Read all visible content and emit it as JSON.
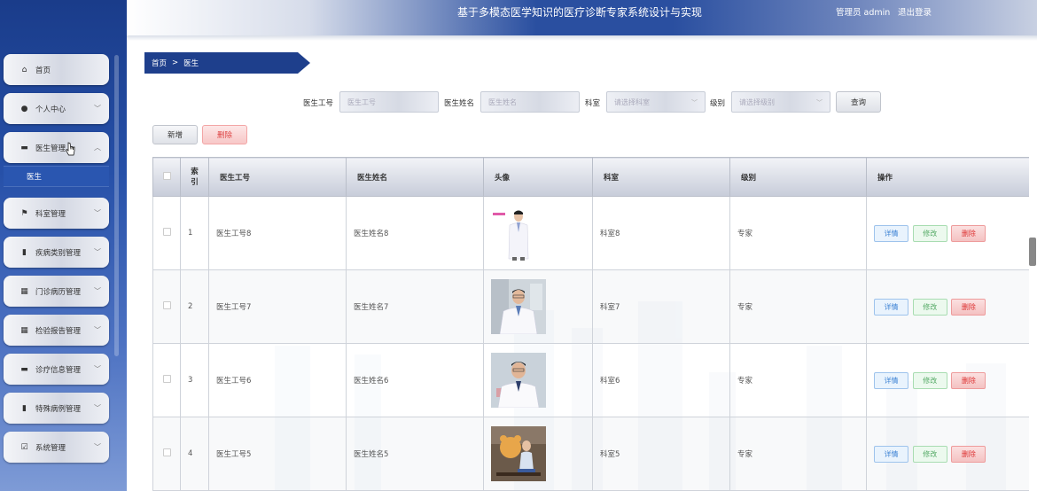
{
  "header": {
    "title": "基于多模态医学知识的医疗诊断专家系统设计与实现",
    "user": "管理员 admin",
    "logout": "退出登录"
  },
  "sidebar": {
    "items": [
      {
        "label": "首页",
        "icon": "home-icon",
        "glyph": "⌂"
      },
      {
        "label": "个人中心",
        "icon": "person-icon",
        "glyph": "●"
      },
      {
        "label": "医生管理",
        "icon": "doctor-icon",
        "glyph": "▬"
      },
      {
        "label": "科室管理",
        "icon": "flag-icon",
        "glyph": "⚑"
      },
      {
        "label": "疾病类别管理",
        "icon": "bar-chart-icon",
        "glyph": "▮"
      },
      {
        "label": "门诊病历管理",
        "icon": "grid-icon",
        "glyph": "▦"
      },
      {
        "label": "检验报告管理",
        "icon": "grid-icon",
        "glyph": "▦"
      },
      {
        "label": "诊疗信息管理",
        "icon": "monitor-icon",
        "glyph": "▬"
      },
      {
        "label": "特殊病例管理",
        "icon": "chart-icon",
        "glyph": "▮"
      },
      {
        "label": "系统管理",
        "icon": "check-square-icon",
        "glyph": "☑"
      }
    ],
    "sub_item": "医生"
  },
  "breadcrumb": {
    "home": "首页",
    "sep": ">",
    "current": "医生"
  },
  "search": {
    "doctor_no_label": "医生工号",
    "doctor_no_placeholder": "医生工号",
    "doctor_name_label": "医生姓名",
    "doctor_name_placeholder": "医生姓名",
    "dept_label": "科室",
    "dept_placeholder": "请选择科室",
    "level_label": "级别",
    "level_placeholder": "请选择级别",
    "query": "查询"
  },
  "actions": {
    "add": "新增",
    "delete": "删除"
  },
  "table": {
    "headers": {
      "index": "索引",
      "no": "医生工号",
      "name": "医生姓名",
      "avatar": "头像",
      "dept": "科室",
      "level": "级别",
      "ops": "操作"
    },
    "ops": {
      "detail": "详情",
      "edit": "修改",
      "delete": "删除"
    },
    "rows": [
      {
        "index": "1",
        "no": "医生工号8",
        "name": "医生姓名8",
        "dept": "科室8",
        "level": "专家"
      },
      {
        "index": "2",
        "no": "医生工号7",
        "name": "医生姓名7",
        "dept": "科室7",
        "level": "专家"
      },
      {
        "index": "3",
        "no": "医生工号6",
        "name": "医生姓名6",
        "dept": "科室6",
        "level": "专家"
      },
      {
        "index": "4",
        "no": "医生工号5",
        "name": "医生姓名5",
        "dept": "科室5",
        "level": "专家"
      }
    ]
  }
}
